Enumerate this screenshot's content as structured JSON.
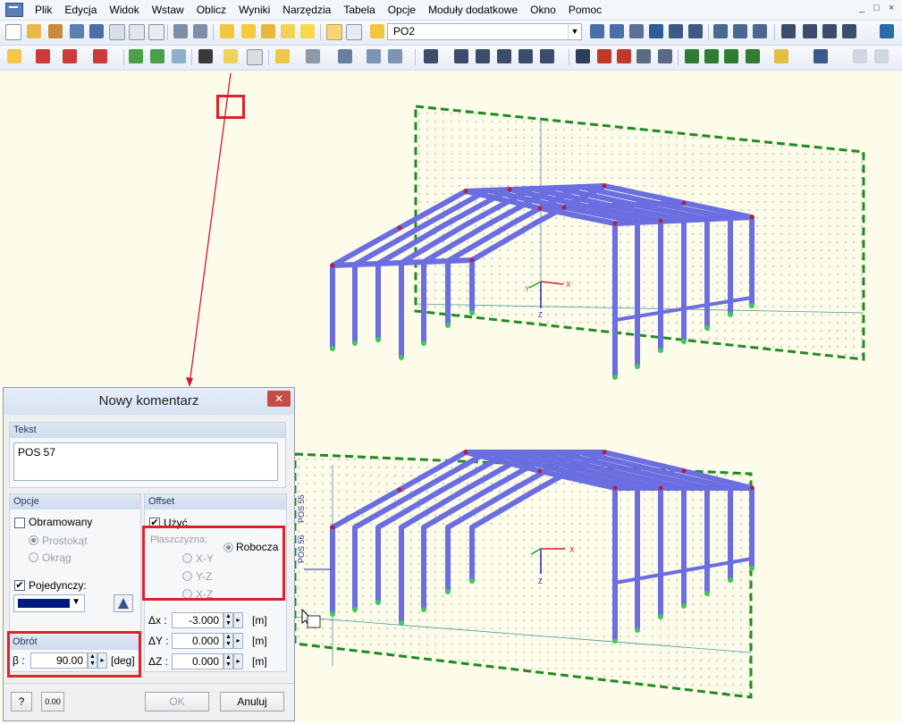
{
  "menu": [
    "Plik",
    "Edycja",
    "Widok",
    "Wstaw",
    "Oblicz",
    "Wyniki",
    "Narzędzia",
    "Tabela",
    "Opcje",
    "Moduły dodatkowe",
    "Okno",
    "Pomoc"
  ],
  "window_controls": [
    "_",
    "□",
    "×"
  ],
  "toolbar": {
    "load_combo_value": "PO2"
  },
  "colors": {
    "member": "#6a6ee0",
    "node": "#b0203c",
    "support": "#3fc75b",
    "work_plane": "#1e8c1e",
    "highlight": "#e0202a",
    "comment_color": "#001a80"
  },
  "view": {
    "top_axis_x": "X",
    "top_axis_y": "Y",
    "top_axis_z": "Z",
    "bottom_axis_x": "X",
    "bottom_axis_z": "Z",
    "comment_labels": [
      "POS 55",
      "POS 56"
    ]
  },
  "dialog": {
    "title": "Nowy komentarz",
    "close_glyph": "✕",
    "text_group_title": "Tekst",
    "text_value": "POS 57",
    "options_title": "Opcje",
    "framed_label": "Obramowany",
    "rectangle_label": "Prostokąt",
    "circle_label": "Okrąg",
    "single_label": "Pojedynczy:",
    "rotation_title": "Obrót",
    "beta_label": "β :",
    "beta_value": "90.00",
    "beta_unit": "[deg]",
    "offset_title": "Offset",
    "use_label": "Użyć",
    "plane_label": "Płaszczyzna:",
    "work_plane_label": "Robocza",
    "plane_xy": "X-Y",
    "plane_yz": "Y-Z",
    "plane_xz": "X-Z",
    "dx_label": "Δx :",
    "dx_value": "-3.000",
    "dy_label": "ΔY :",
    "dy_value": "0.000",
    "dz_label": "ΔZ :",
    "dz_value": "0.000",
    "unit_m": "[m]",
    "ok_label": "OK",
    "cancel_label": "Anuluj",
    "units_icon_text": "0.00"
  }
}
